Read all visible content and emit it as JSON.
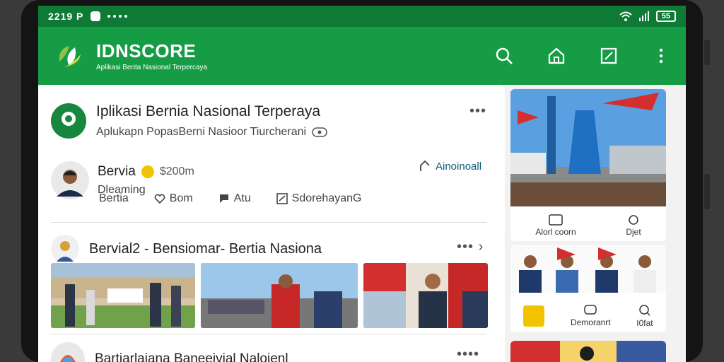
{
  "status": {
    "time": "2219 P",
    "battery": "55"
  },
  "app": {
    "name": "IDNSCORE",
    "tagline": "Aplikasi Berita Nasional Terpercaya"
  },
  "actions": [
    "search-icon",
    "home-icon",
    "edit-icon",
    "more-vert-icon"
  ],
  "post1": {
    "title": "Iplikasi Bernia Nasional Terperaya",
    "subtitle": "Aplukapn PopasBerni Nasioor Tiurcherani",
    "author": "Bervia",
    "badge_value": "$200m",
    "author_sub": "Dleaming",
    "follow": "Ainoinoall",
    "meta": {
      "tag": "Bertia",
      "like": "Bom",
      "comment": "Atu",
      "share": "SdorehayanG"
    }
  },
  "post2": {
    "title": "Bervial2 - Bensiomar- Bertia Nasiona"
  },
  "post3": {
    "title": "Bartiarlaiana Baneeivial Naloienl"
  },
  "side_cards": [
    {
      "labels": [
        "Alorl coorn",
        "Djet"
      ]
    },
    {
      "labels": [
        "Demoranrt",
        "I0fat"
      ]
    }
  ],
  "colors": {
    "brand": "#179c46",
    "status": "#0f7a35"
  }
}
